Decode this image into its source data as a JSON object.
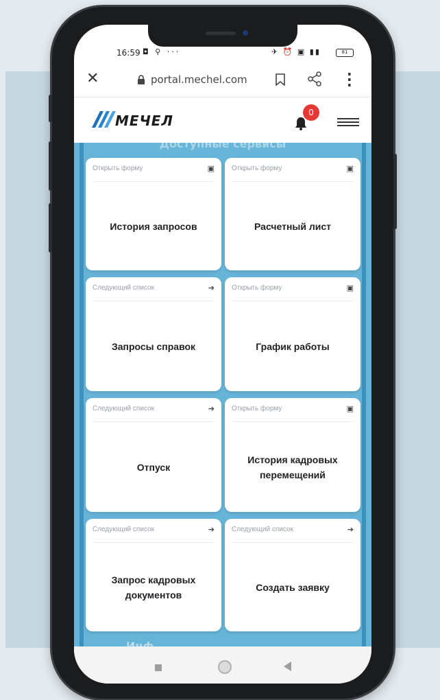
{
  "status_bar": {
    "time": "16:59",
    "left_icons": "◘ ⚲ ···",
    "right_icons": "✈ ⏰ ▣ ▮▮",
    "battery": "81"
  },
  "browser": {
    "url": "portal.mechel.com"
  },
  "header": {
    "logo_text": "МЕЧЕЛ",
    "notification_count": "0"
  },
  "content": {
    "section_title": "Доступные сервисы",
    "section_title_bottom": "Инф...",
    "cards": [
      {
        "hint": "Открыть форму",
        "hint_icon": "copy-icon",
        "title": "История запросов"
      },
      {
        "hint": "Открыть форму",
        "hint_icon": "copy-icon",
        "title": "Расчетный лист"
      },
      {
        "hint": "Следующий список",
        "hint_icon": "arrow-right-icon",
        "title": "Запросы справок"
      },
      {
        "hint": "Открыть форму",
        "hint_icon": "copy-icon",
        "title": "График работы"
      },
      {
        "hint": "Следующий список",
        "hint_icon": "arrow-right-icon",
        "title": "Отпуск"
      },
      {
        "hint": "Открыть форму",
        "hint_icon": "copy-icon",
        "title": "История кадровых перемещений"
      },
      {
        "hint": "Следующий список",
        "hint_icon": "arrow-right-icon",
        "title": "Запрос кадровых документов"
      },
      {
        "hint": "Следующий список",
        "hint_icon": "arrow-right-icon",
        "title": "Создать заявку"
      }
    ]
  },
  "colors": {
    "content_bg": "#66b4d8",
    "badge": "#e53935",
    "page_bg": "#c6d7e2"
  }
}
